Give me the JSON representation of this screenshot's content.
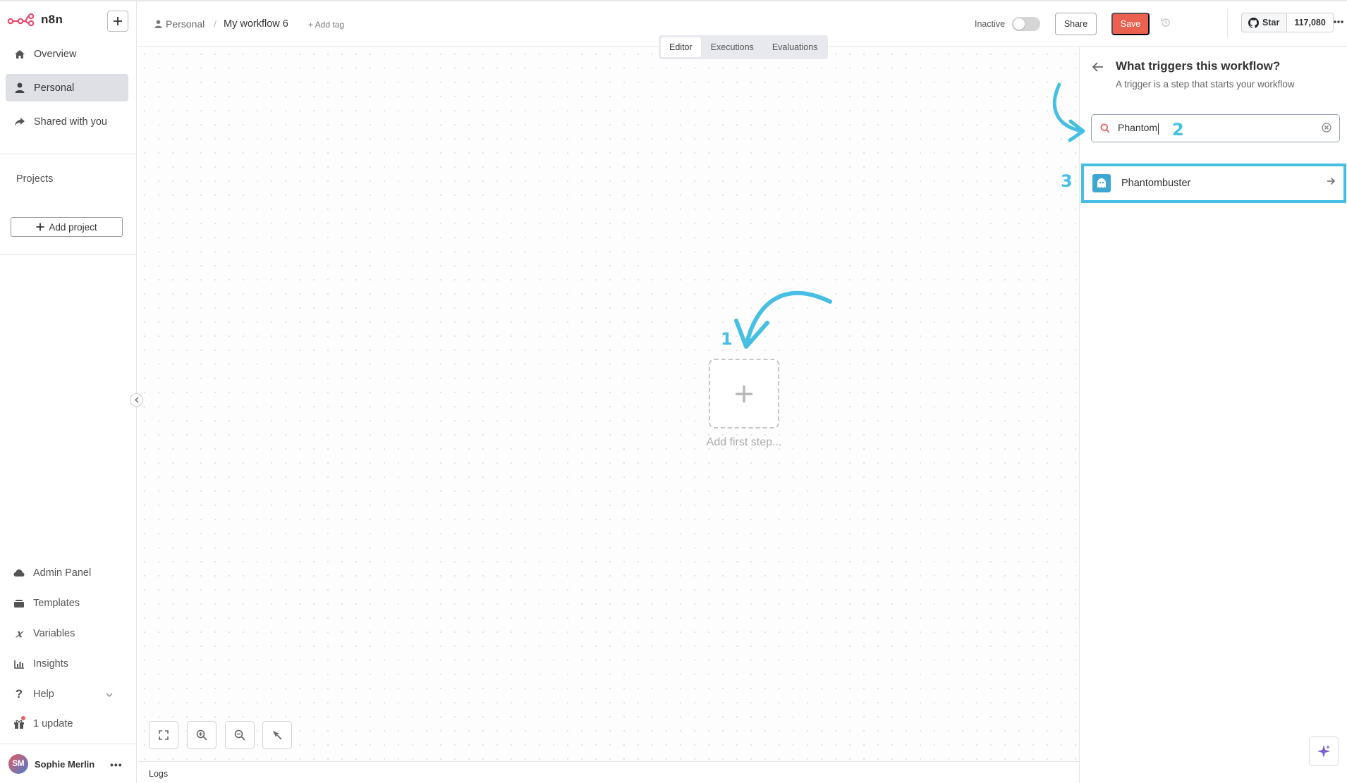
{
  "sidebar": {
    "logo_text": "n8n",
    "nav": [
      {
        "label": "Overview",
        "icon": "home-icon"
      },
      {
        "label": "Personal",
        "icon": "user-icon",
        "active": true
      },
      {
        "label": "Shared with you",
        "icon": "share-icon"
      }
    ],
    "projects_label": "Projects",
    "add_project_label": "Add project",
    "bottom": [
      {
        "label": "Admin Panel",
        "icon": "cloud-icon"
      },
      {
        "label": "Templates",
        "icon": "templates-icon"
      },
      {
        "label": "Variables",
        "icon": "variables-icon"
      },
      {
        "label": "Insights",
        "icon": "insights-icon"
      },
      {
        "label": "Help",
        "icon": "help-icon"
      },
      {
        "label": "1 update",
        "icon": "gift-icon"
      }
    ],
    "user": {
      "initials": "SM",
      "name": "Sophie Merlin"
    }
  },
  "header": {
    "breadcrumb_project": "Personal",
    "breadcrumb_sep": "/",
    "workflow_title": "My workflow 6",
    "add_tag": "+ Add tag",
    "status_label": "Inactive",
    "share_label": "Share",
    "save_label": "Save",
    "github": {
      "star_label": "Star",
      "count": "117,080"
    }
  },
  "canvas": {
    "tabs": [
      {
        "label": "Editor",
        "active": true
      },
      {
        "label": "Executions"
      },
      {
        "label": "Evaluations"
      }
    ],
    "add_first_step_label": "Add first step...",
    "logs_label": "Logs"
  },
  "panel": {
    "title": "What triggers this workflow?",
    "subtitle": "A trigger is a step that starts your workflow",
    "search_value": "Phantom",
    "results": [
      {
        "name": "Phantombuster"
      }
    ]
  },
  "annotations": {
    "step1": "1",
    "step2": "2",
    "step3": "3",
    "color": "#46bfe4"
  },
  "colors": {
    "save": "#ea6150",
    "accent_annotation": "#46bfe4",
    "active_nav": "#dfe0e6"
  }
}
